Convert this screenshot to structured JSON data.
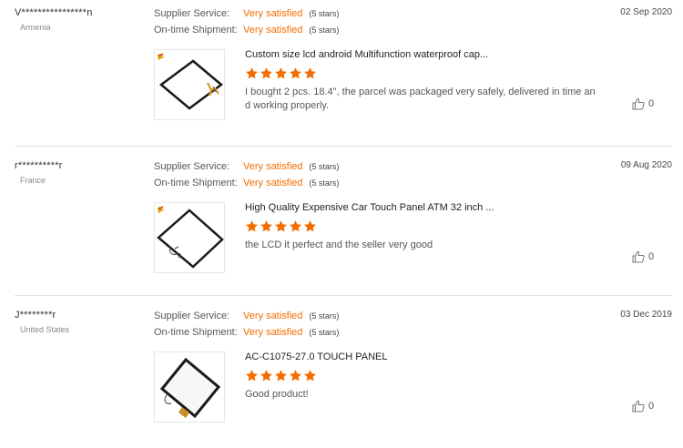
{
  "reviews": [
    {
      "user": "V****************n",
      "country": "Armenia",
      "date": "02 Sep 2020",
      "supplier_label": "Supplier Service:",
      "supplier_value": "Very satisfied",
      "supplier_stars": "(5 stars)",
      "shipment_label": "On-time Shipment:",
      "shipment_value": "Very satisfied",
      "shipment_stars": "(5 stars)",
      "product_title": "Custom size lcd android Multifunction waterproof cap...",
      "rating": 5,
      "comment": "I bought 2 pcs. 18.4\", the parcel was packaged very safely, delivered in time and working properly.",
      "helpful_count": "0"
    },
    {
      "user": "r**********r",
      "country": "France",
      "date": "09 Aug 2020",
      "supplier_label": "Supplier Service:",
      "supplier_value": "Very satisfied",
      "supplier_stars": "(5 stars)",
      "shipment_label": "On-time Shipment:",
      "shipment_value": "Very satisfied",
      "shipment_stars": "(5 stars)",
      "product_title": "High Quality Expensive Car Touch Panel ATM 32 inch ...",
      "rating": 5,
      "comment": "the LCD it perfect and the seller very good",
      "helpful_count": "0"
    },
    {
      "user": "J********r",
      "country": "United States",
      "date": "03 Dec 2019",
      "supplier_label": "Supplier Service:",
      "supplier_value": "Very satisfied",
      "supplier_stars": "(5 stars)",
      "shipment_label": "On-time Shipment:",
      "shipment_value": "Very satisfied",
      "shipment_stars": "(5 stars)",
      "product_title": "AC-C1075-27.0 TOUCH PANEL",
      "rating": 5,
      "comment": "Good product!",
      "helpful_count": "0"
    }
  ],
  "colors": {
    "accent": "#f36d00",
    "star": "#f36d00",
    "divider": "#e3e3e3"
  },
  "icons": {
    "star": "star-icon",
    "helpful": "thumbs-up-icon",
    "product": "touch-panel-image"
  }
}
